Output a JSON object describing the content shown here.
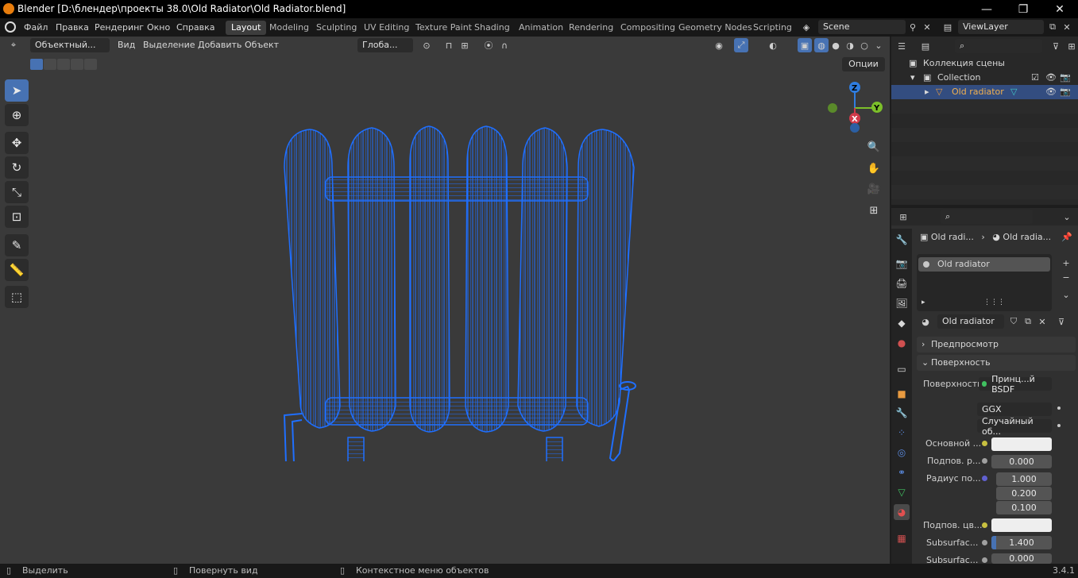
{
  "window": {
    "title": "Blender [D:\\блендер\\проекты 38.0\\Old Radiator\\Old Radiator.blend]"
  },
  "menus": [
    "Файл",
    "Правка",
    "Рендеринг",
    "Окно",
    "Справка"
  ],
  "workspaces": [
    "Layout",
    "Modeling",
    "Sculpting",
    "UV Editing",
    "Texture Paint",
    "Shading",
    "Animation",
    "Rendering",
    "Compositing",
    "Geometry Nodes",
    "Scripting"
  ],
  "scene": "Scene",
  "view_layer": "ViewLayer",
  "viewport": {
    "mode": "Объектный...",
    "menus": [
      "Вид",
      "Выделение",
      "Добавить",
      "Объект"
    ],
    "transform_orientation": "Глоба...",
    "options": "Опции",
    "gizmo": {
      "z": "Z",
      "y": "Y",
      "x": "X"
    }
  },
  "outliner": {
    "scene_collection": "Коллекция сцены",
    "collection": "Collection",
    "object": "Old radiator"
  },
  "properties": {
    "breadcrumb_object": "Old radi...",
    "breadcrumb_material": "Old radia...",
    "slot": "Old radiator",
    "material_name": "Old radiator",
    "preview": "Предпросмотр",
    "surface_panel": "Поверхность",
    "surface_label": "Поверхность",
    "surface_value": "Принц...й BSDF",
    "distribution": "GGX",
    "subsurface_method": "Случайный об...",
    "base_color_label": "Основной ...",
    "subsurface_label": "Подпов. р...",
    "subsurface_value": "0.000",
    "radius_label": "Радиус по...",
    "radius": [
      "1.000",
      "0.200",
      "0.100"
    ],
    "subsurface_color_label": "Подпов. цв...",
    "ior_label": "Subsurfac...",
    "ior_value": "1.400",
    "aniso_label": "Subsurfac...",
    "aniso_value": "0.000"
  },
  "status": {
    "select": "Выделить",
    "rotate": "Повернуть вид",
    "context": "Контекстное меню объектов",
    "version": "3.4.1"
  },
  "colors": {
    "wire": "#1f6fff",
    "active_tab": "#4772b3"
  }
}
